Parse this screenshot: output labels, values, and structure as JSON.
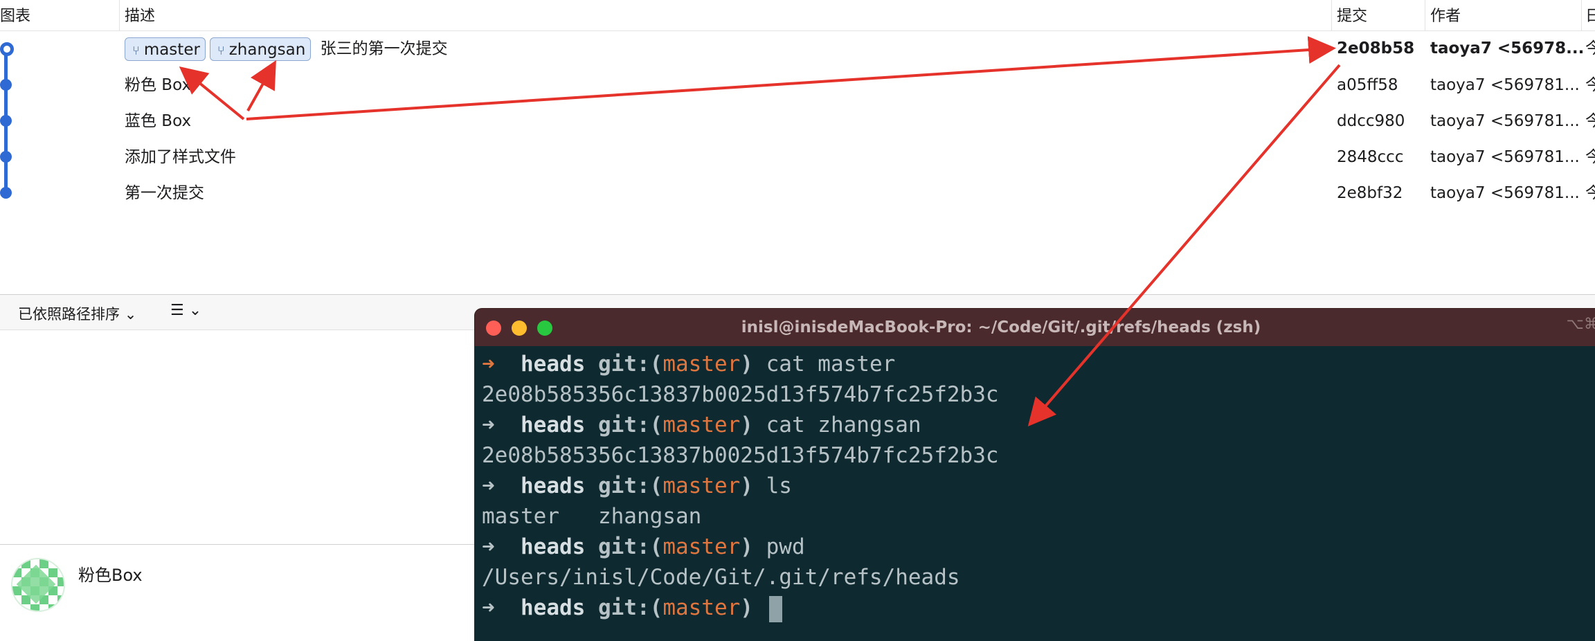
{
  "columns": {
    "graph": "图表",
    "description": "描述",
    "commit": "提交",
    "author": "作者",
    "date": "日"
  },
  "commits": [
    {
      "branches": [
        "master",
        "zhangsan"
      ],
      "message": "张三的第一次提交",
      "sha": "2e08b58",
      "author": "taoya7 <56978...",
      "date": "今"
    },
    {
      "message": "粉色 Box",
      "sha": "a05ff58",
      "author": "taoya7 <569781...",
      "date": "今"
    },
    {
      "message": "蓝色 Box",
      "sha": "ddcc980",
      "author": "taoya7 <569781...",
      "date": "今"
    },
    {
      "message": "添加了样式文件",
      "sha": "2848ccc",
      "author": "taoya7 <569781...",
      "date": "今"
    },
    {
      "message": "第一次提交",
      "sha": "2e8bf32",
      "author": "taoya7 <569781...",
      "date": "今"
    }
  ],
  "toolbar": {
    "sort_label": "已依照路径排序",
    "list_icon": "list-icon",
    "chevron": "chevron-down-icon"
  },
  "details": {
    "commit_title": "粉色Box"
  },
  "terminal": {
    "title": "inisl@inisdeMacBook-Pro: ~/Code/Git/.git/refs/heads (zsh)",
    "shortcut": "⌥⌘",
    "prompt_dir": "heads",
    "git_label": "git:",
    "branch": "master",
    "arrow": "➜",
    "lines": [
      {
        "type": "cmd",
        "cmd": "cat master",
        "active": true
      },
      {
        "type": "out",
        "text": "2e08b585356c13837b0025d13f574b7fc25f2b3c"
      },
      {
        "type": "cmd",
        "cmd": "cat zhangsan"
      },
      {
        "type": "out",
        "text": "2e08b585356c13837b0025d13f574b7fc25f2b3c"
      },
      {
        "type": "cmd",
        "cmd": "ls"
      },
      {
        "type": "out",
        "text": "master   zhangsan"
      },
      {
        "type": "cmd",
        "cmd": "pwd"
      },
      {
        "type": "out",
        "text": "/Users/inisl/Code/Git/.git/refs/heads"
      },
      {
        "type": "cmd",
        "cmd": "",
        "cursor": true
      }
    ]
  },
  "colors": {
    "graph": "#2f6ad4",
    "annotation": "#e5322b",
    "terminal_bg": "#0e2a30",
    "terminal_titlebar": "#4a2a2c",
    "branch_text": "#e0763f"
  }
}
